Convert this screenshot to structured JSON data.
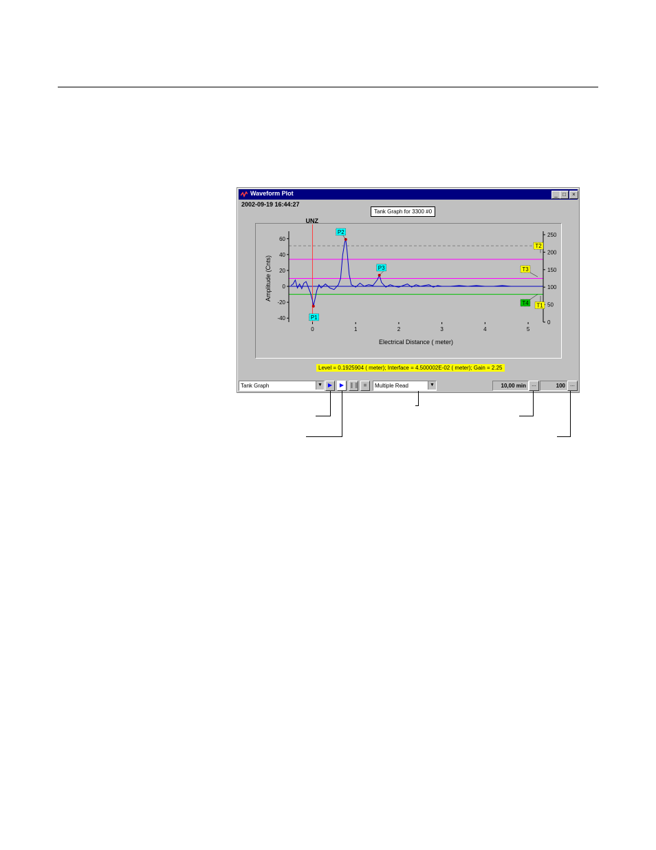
{
  "window": {
    "title": "Waveform Plot",
    "buttons": {
      "minimize": "_",
      "maximize": "□",
      "close": "×"
    }
  },
  "timestamp": "2002-09-19 16:44:27",
  "graph_title": "Tank Graph for 3300 #0",
  "status_line": "Level = 0.1925904 ( meter); Interface = 4.500002E-02 ( meter); Gain = 2.25",
  "toolbar": {
    "view_select": "Tank Graph",
    "read_mode_select": "Multiple Read",
    "interval_value": "10,00 min",
    "interval_button": "...",
    "count_value": "100",
    "count_button": "..."
  },
  "chart_data": {
    "type": "line",
    "xlabel": "Electrical Distance ( meter)",
    "ylabel": "Amplitude (Cnts)",
    "xlim": [
      -0.55,
      5.35
    ],
    "ylim": [
      -45,
      65
    ],
    "y2lim": [
      0,
      250
    ],
    "x_ticks": [
      "0",
      "1",
      "2",
      "3",
      "4",
      "5"
    ],
    "y_ticks": [
      "-40",
      "-20",
      "0",
      "20",
      "40",
      "60"
    ],
    "y2_ticks": [
      "0",
      "50",
      "100",
      "150",
      "200",
      "250"
    ],
    "unz_label": "UNZ",
    "unz_x": 0,
    "thresholds": [
      {
        "amplitude": 51,
        "style": "dashed",
        "color": "#808080"
      },
      {
        "amplitude": 34,
        "style": "solid",
        "color": "#ff00ff"
      },
      {
        "amplitude": 10,
        "style": "solid",
        "color": "#ff00ff"
      },
      {
        "amplitude": -10,
        "style": "solid",
        "color": "#00c000"
      }
    ],
    "peaks": [
      {
        "label": "P1",
        "x": 0.02,
        "y": -25,
        "color": "#00ffff"
      },
      {
        "label": "P2",
        "x": 0.77,
        "y": 59,
        "color": "#00ffff"
      },
      {
        "label": "P3",
        "x": 1.55,
        "y": 14,
        "color": "#00ffff"
      }
    ],
    "tank_labels": [
      {
        "label": "T2",
        "color": "#ffff00"
      },
      {
        "label": "T3",
        "color": "#ffff00"
      },
      {
        "label": "T4",
        "color": "#00c000"
      },
      {
        "label": "T1",
        "color": "#ffff00"
      }
    ],
    "series": [
      {
        "color": "#0000c0",
        "x": [
          -0.5,
          -0.45,
          -0.4,
          -0.35,
          -0.3,
          -0.25,
          -0.2,
          -0.15,
          -0.1,
          -0.05,
          0,
          0.02,
          0.05,
          0.1,
          0.15,
          0.2,
          0.3,
          0.4,
          0.5,
          0.6,
          0.65,
          0.7,
          0.75,
          0.77,
          0.8,
          0.85,
          0.9,
          1.0,
          1.1,
          1.2,
          1.3,
          1.4,
          1.5,
          1.55,
          1.6,
          1.7,
          1.8,
          1.9,
          2.0,
          2.1,
          2.2,
          2.3,
          2.4,
          2.5,
          2.6,
          2.7,
          2.8,
          2.9,
          3.0,
          3.2,
          3.4,
          3.6,
          3.8,
          4.0,
          4.2,
          4.4,
          4.6,
          5.0,
          5.3
        ],
        "y": [
          1,
          3,
          8,
          -2,
          3,
          -3,
          4,
          6,
          -1,
          -8,
          -18,
          -25,
          -18,
          -5,
          2,
          -2,
          3,
          -2,
          -4,
          2,
          10,
          40,
          56,
          59,
          45,
          15,
          2,
          -1,
          4,
          0,
          2,
          1,
          8,
          14,
          5,
          -1,
          2,
          0,
          -1,
          1,
          3,
          -1,
          2,
          0,
          1,
          2,
          -1,
          1,
          0,
          0,
          1,
          0,
          1,
          0,
          0,
          1,
          0,
          0,
          0
        ]
      }
    ]
  }
}
